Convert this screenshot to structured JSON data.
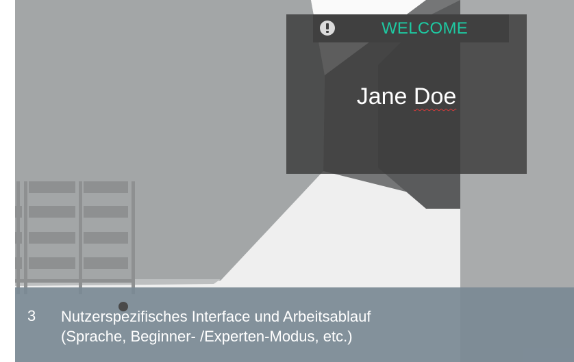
{
  "welcome_panel": {
    "header_label": "WELCOME",
    "user_first": "Jane",
    "user_last": "Doe",
    "accent_color": "#1ec9a2",
    "header_icon": "exclamation-circle-icon"
  },
  "caption": {
    "number": "3",
    "line1": "Nutzerspezifisches Interface und Arbeitsablauf",
    "line2": "(Sprache, Beginner- /Experten-Modus, etc.)"
  }
}
